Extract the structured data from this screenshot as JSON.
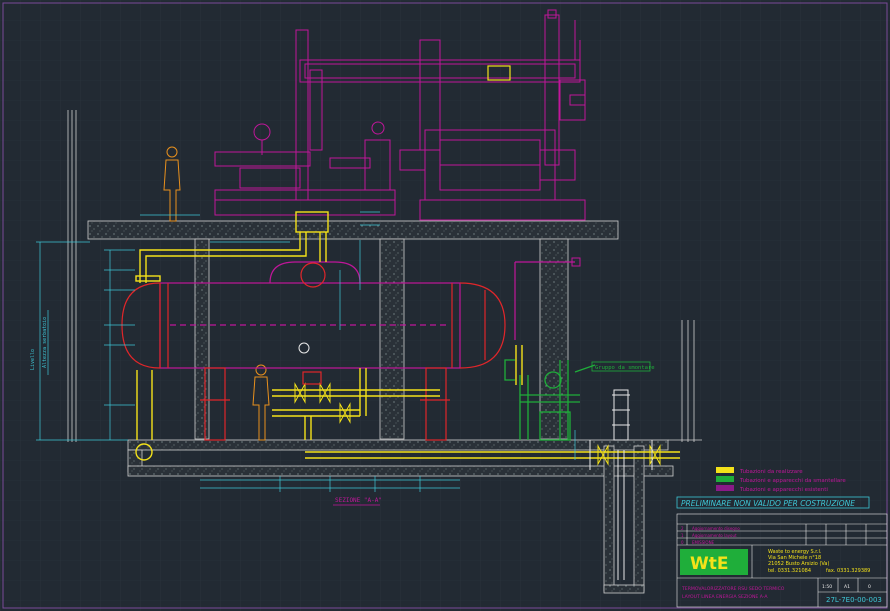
{
  "colors": {
    "background": "#222a33",
    "grid": "#2c3540",
    "structure": "#cfcfcf",
    "magenta": "#c0169a",
    "red": "#e0262a",
    "yellow": "#f4e21a",
    "green": "#1fae3a",
    "cyan": "#3ec7d6",
    "orange": "#e8901d",
    "white": "#e8e8e8"
  },
  "labels": {
    "section": "SEZIONE \"A-A\"",
    "green_callout": "Gruppo da smontare",
    "dim_left": "Altezza serbatoio",
    "dim_left_b": "Livello"
  },
  "legend": [
    {
      "color": "#f4e21a",
      "text": "Tubazioni da realizzare"
    },
    {
      "color": "#1fae3a",
      "text": "Tubazioni e apparecchi da smantellare"
    },
    {
      "color": "#8a1a88",
      "text": "Tubazioni e apparecchi esistenti"
    }
  ],
  "stamp": "PRELIMINARE NON VALIDO PER COSTRUZIONE",
  "title_block": {
    "logo": "WtE",
    "company": [
      "Waste to energy S.r.l.",
      "Via San Michele n°18",
      "21052 Busto Arsizio (Va)",
      "tel. 0331.321084",
      "fax. 0331.329389"
    ],
    "project": "TERMOVALORIZZATORE RSU SEDO TERMICO",
    "drawing_title": "LAYOUT LINEA ENERGIA  SEZIONE A-A",
    "drawing_number": "27L-7E0-00-003",
    "scale": "1:50",
    "sheet": "A1",
    "revision": "0",
    "revisions": [
      {
        "rev": "2",
        "desc": "Aggiornamento disegno"
      },
      {
        "rev": "1",
        "desc": "Aggiornamento layout"
      },
      {
        "rev": "0",
        "desc": "EMISSIONE"
      }
    ]
  }
}
